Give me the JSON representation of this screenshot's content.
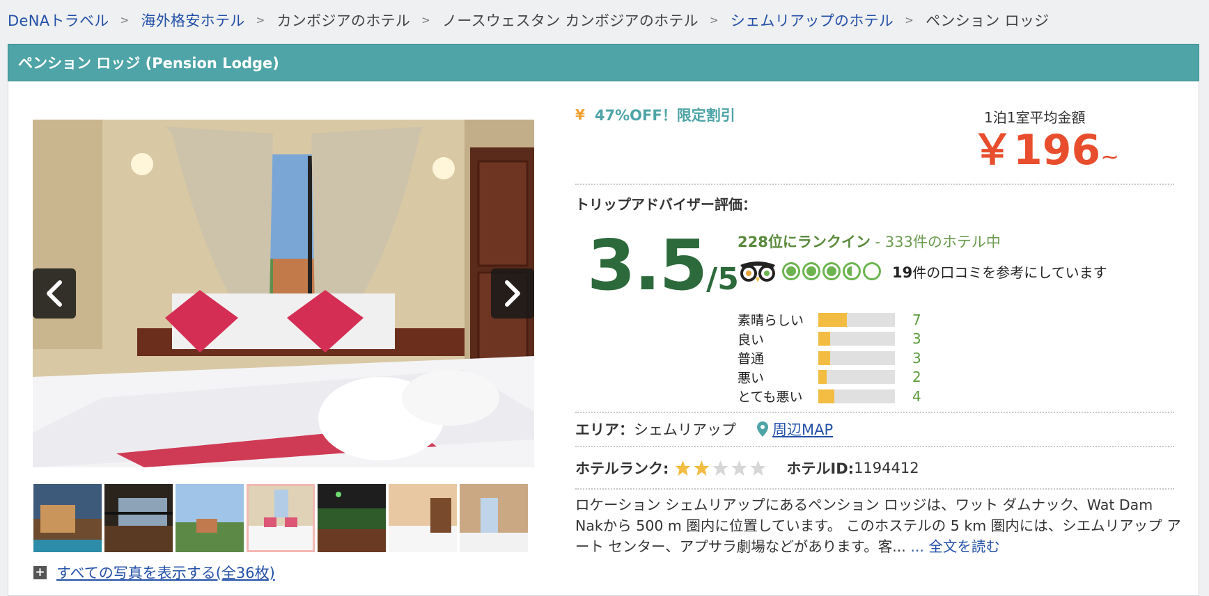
{
  "breadcrumb": {
    "items": [
      {
        "label": "DeNAトラベル",
        "link": true
      },
      {
        "label": "海外格安ホテル",
        "link": true
      },
      {
        "label": "カンボジアのホテル",
        "link": false
      },
      {
        "label": "ノースウェスタン カンボジアのホテル",
        "link": false
      },
      {
        "label": "シェムリアップのホテル",
        "link": true
      },
      {
        "label": "ペンション ロッジ",
        "link": false
      }
    ],
    "separator": ">"
  },
  "hotel": {
    "title": "ペンション ロッジ (Pension Lodge)"
  },
  "gallery": {
    "thumbnail_count": 7,
    "active_thumbnail": 4,
    "show_all_label": "すべての写真を表示する(全36枚)"
  },
  "discount": {
    "icon": "yen-icon",
    "label": "47%OFF！限定割引"
  },
  "price": {
    "label": "1泊1室平均金額",
    "amount": "￥196",
    "suffix": "~"
  },
  "tripadvisor": {
    "label": "トリップアドバイザー評価：",
    "score": "3.5",
    "score_max": "/5",
    "bubble_rating": 3.5,
    "rank_text": "228位にランクイン",
    "rank_suffix": " - 333件のホテル中",
    "review_count": "19",
    "review_text": "件の口コミを参考にしています",
    "distribution": [
      {
        "label": "素晴らしい",
        "count": "7"
      },
      {
        "label": "良い",
        "count": "3"
      },
      {
        "label": "普通",
        "count": "3"
      },
      {
        "label": "悪い",
        "count": "2"
      },
      {
        "label": "とても悪い",
        "count": "4"
      }
    ]
  },
  "area": {
    "label": "エリア：",
    "value": "シェムリアップ",
    "map_link": "周辺MAP"
  },
  "hotel_rank": {
    "label": "ホテルランク:",
    "stars": 2,
    "stars_max": 5,
    "id_label": "ホテルID:",
    "id_value": "1194412"
  },
  "description": {
    "text": "ロケーション シェムリアップにあるペンション ロッジは、ワット ダムナック、Wat Dam Nakから 500 m 圏内に位置しています。 このホステルの 5 km 圏内には、シエムリアップ アート センター、アプサラ劇場などがあります。客...",
    "read_more": " ... 全文を読む"
  },
  "colors": {
    "title_bar": "#4ea4a6",
    "price": "#e84e2d",
    "score": "#2c6a3c",
    "bar_fill": "#f2bd42",
    "link": "#2350a8"
  }
}
